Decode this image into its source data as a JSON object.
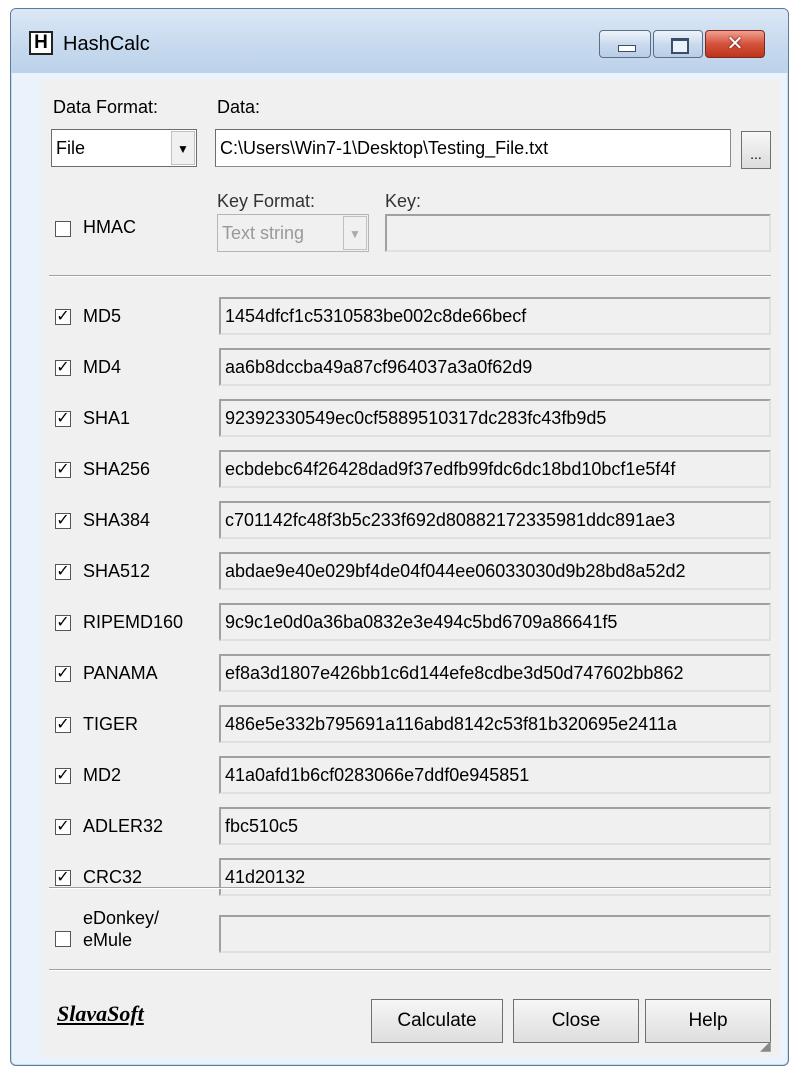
{
  "window": {
    "title": "HashCalc",
    "app_icon_letter": "H"
  },
  "data_format": {
    "label": "Data Format:",
    "value": "File"
  },
  "data": {
    "label": "Data:",
    "value": "C:\\Users\\Win7-1\\Desktop\\Testing_File.txt",
    "browse_label": "..."
  },
  "hmac": {
    "label": "HMAC",
    "checked": false,
    "key_format_label": "Key Format:",
    "key_format_value": "Text string",
    "key_label": "Key:",
    "key_value": ""
  },
  "hashes": [
    {
      "name": "MD5",
      "checked": true,
      "value": "1454dfcf1c5310583be002c8de66becf"
    },
    {
      "name": "MD4",
      "checked": true,
      "value": "aa6b8dccba49a87cf964037a3a0f62d9"
    },
    {
      "name": "SHA1",
      "checked": true,
      "value": "92392330549ec0cf5889510317dc283fc43fb9d5"
    },
    {
      "name": "SHA256",
      "checked": true,
      "value": "ecbdebc64f26428dad9f37edfb99fdc6dc18bd10bcf1e5f4f"
    },
    {
      "name": "SHA384",
      "checked": true,
      "value": "c701142fc48f3b5c233f692d80882172335981ddc891ae3"
    },
    {
      "name": "SHA512",
      "checked": true,
      "value": "abdae9e40e029bf4de04f044ee06033030d9b28bd8a52d2"
    },
    {
      "name": "RIPEMD160",
      "checked": true,
      "value": "9c9c1e0d0a36ba0832e3e494c5bd6709a86641f5"
    },
    {
      "name": "PANAMA",
      "checked": true,
      "value": "ef8a3d1807e426bb1c6d144efe8cdbe3d50d747602bb862"
    },
    {
      "name": "TIGER",
      "checked": true,
      "value": "486e5e332b795691a116abd8142c53f81b320695e2411a"
    },
    {
      "name": "MD2",
      "checked": true,
      "value": "41a0afd1b6cf0283066e7ddf0e945851"
    },
    {
      "name": "ADLER32",
      "checked": true,
      "value": "fbc510c5"
    },
    {
      "name": "CRC32",
      "checked": true,
      "value": "41d20132"
    }
  ],
  "edonkey": {
    "label_line1": "eDonkey/",
    "label_line2": "eMule",
    "checked": false,
    "value": ""
  },
  "footer": {
    "logo": "SlavaSoft",
    "calculate_label": "Calculate",
    "close_label": "Close",
    "help_label": "Help"
  },
  "icons": {
    "minimize": "minimize-icon",
    "maximize": "maximize-icon",
    "close": "close-icon",
    "dropdown": "chevron-down-icon",
    "resize": "resize-grip-icon"
  }
}
